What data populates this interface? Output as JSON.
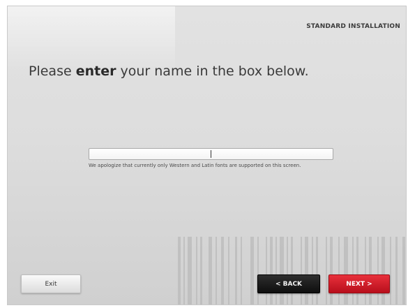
{
  "header": {
    "mode_label": "STANDARD INSTALLATION"
  },
  "prompt": {
    "before": "Please ",
    "emphasis": "enter",
    "after": " your name in the box below."
  },
  "name_input": {
    "value": "",
    "placeholder": ""
  },
  "notice": {
    "text": "We apologize that currently only Western and Latin fonts are supported on this screen."
  },
  "buttons": {
    "exit": "Exit",
    "back": "< BACK",
    "next": "NEXT >"
  },
  "colors": {
    "next_accent": "#d81f2b",
    "back_accent": "#1a1a1a"
  }
}
